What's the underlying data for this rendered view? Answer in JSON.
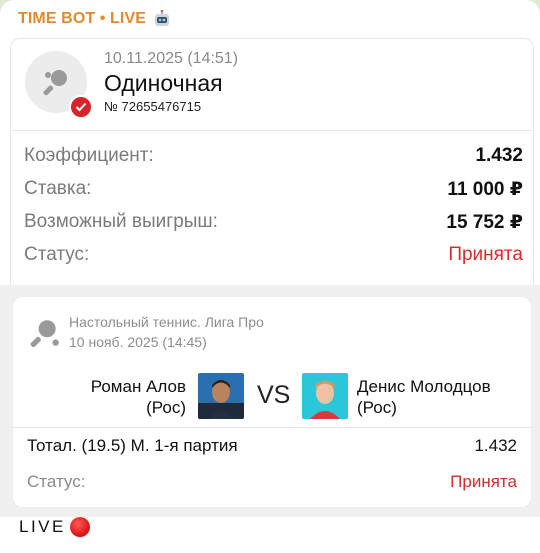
{
  "sender": {
    "name": "TIME BOT • LIVE",
    "icon": "robot-icon"
  },
  "bet": {
    "datetime": "10.11.2025 (14:51)",
    "type": "Одиночная",
    "number": "№ 72655476715",
    "rows": [
      {
        "label": "Коэффициент:",
        "value": "1.432"
      },
      {
        "label": "Ставка:",
        "value": "11 000 ₽"
      },
      {
        "label": "Возможный выигрыш:",
        "value": "15 752 ₽"
      },
      {
        "label": "Статус:",
        "value": "Принята"
      }
    ]
  },
  "event": {
    "league": "Настольный теннис. Лига Про",
    "date": "10 нояб. 2025 (14:45)",
    "team_left": {
      "name": "Роман Алов",
      "country": "(Рос)"
    },
    "team_right": {
      "name": "Денис Молодцов",
      "country": "(Рос)"
    },
    "vs": "VS",
    "market": "Тотал. (19.5) М. 1-я партия",
    "odds": "1.432",
    "status_label": "Статус:",
    "status_value": "Принята"
  },
  "footer": {
    "text": "LIVE"
  },
  "colors": {
    "accent_orange": "#e08a2e",
    "status_red": "#d82b2b",
    "badge_red": "#d8232a"
  }
}
